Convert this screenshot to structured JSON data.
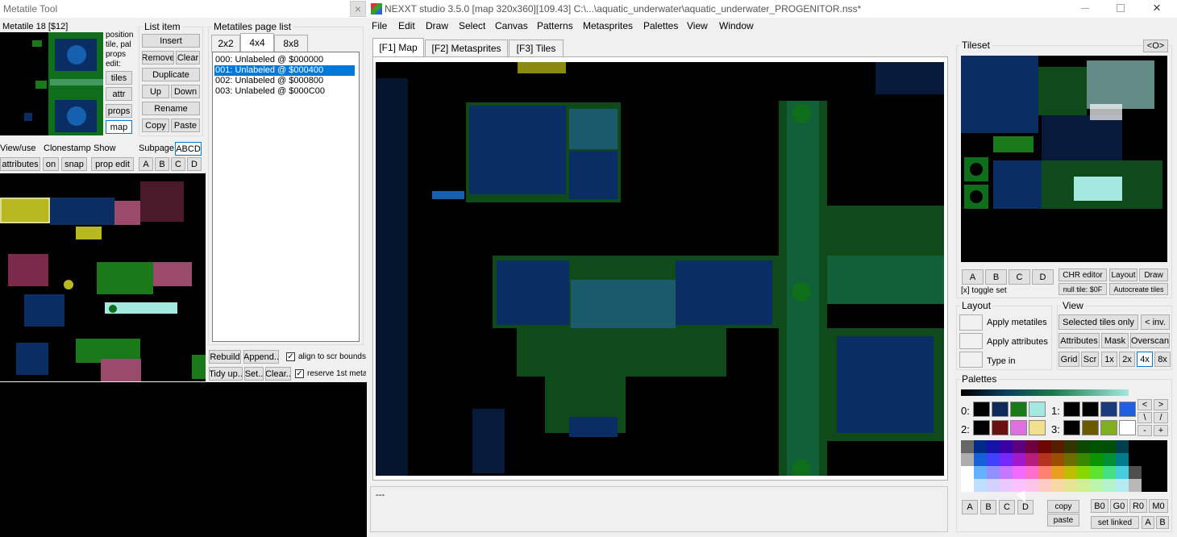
{
  "metatile_window": {
    "title": "Metatile Tool",
    "close": "×",
    "metatile_label": "Metatile 18 [$12]",
    "info_text": [
      "position",
      "tile, pal",
      "props",
      "edit:"
    ],
    "side_buttons": [
      "tiles",
      "attr",
      "props",
      "map"
    ],
    "list_item": {
      "title": "List item",
      "insert": "Insert",
      "remove": "Remove",
      "clear": "Clear",
      "duplicate": "Duplicate",
      "up": "Up",
      "down": "Down",
      "rename": "Rename",
      "copy": "Copy",
      "paste": "Paste"
    },
    "page_list": {
      "title": "Metatiles page list",
      "tabs": [
        "2x2",
        "4x4",
        "8x8"
      ],
      "items": [
        "000: Unlabeled @ $000000",
        "001: Unlabeled @ $000400",
        "002: Unlabeled @ $000800",
        "003: Unlabeled @ $000C00"
      ],
      "selected_index": 1
    },
    "view_use": "View/use",
    "clonestamp": "Clonestamp",
    "show": "Show",
    "subpage": "Subpage",
    "abcd": "ABCD",
    "attributes_btn": "attributes",
    "on_btn": "on",
    "snap_btn": "snap",
    "prop_edit_btn": "prop edit",
    "subpage_letters": [
      "A",
      "B",
      "C",
      "D"
    ],
    "rebuild": "Rebuild",
    "append": "Append..",
    "align_label": "align to scr bounds",
    "tidy": "Tidy up..",
    "set": "Set..",
    "clear_btn": "Clear..",
    "reserve_label": "reserve 1st meta"
  },
  "main_window": {
    "title": "NEXXT studio 3.5.0  [map 320x360][109.43] C:\\...\\aquatic_underwater\\aquatic_underwater_PROGENITOR.nss*",
    "menu": [
      "File",
      "Edit",
      "Draw",
      "Select",
      "Canvas",
      "Patterns",
      "Metasprites",
      "Palettes",
      "View",
      "Window"
    ],
    "tabs": [
      "[F1] Map",
      "[F2] Metasprites",
      "[F3] Tiles"
    ],
    "status_text": "---",
    "tileset": {
      "title": "Tileset",
      "toggle_btn": "<O>",
      "set_buttons": [
        "A",
        "B",
        "C",
        "D"
      ],
      "chr_editor": "CHR editor",
      "layout": "Layout",
      "draw": "Draw",
      "toggle_set": "[x] toggle set",
      "null_tile": "null tile: $0F",
      "autocreate": "Autocreate tiles"
    },
    "layout_group": {
      "title": "Layout",
      "apply_metatiles": "Apply metatiles",
      "apply_attributes": "Apply attributes",
      "type_in": "Type in"
    },
    "view_group": {
      "title": "View",
      "selected_tiles_only": "Selected tiles only",
      "inv": "< inv.",
      "attributes": "Attributes",
      "mask": "Mask",
      "overscan": "Overscan",
      "grid": "Grid",
      "scr": "Scr",
      "zoom": [
        "1x",
        "2x",
        "4x",
        "8x"
      ],
      "zoom_selected": "4x"
    },
    "palettes": {
      "title": "Palettes",
      "labels": [
        "0:",
        "1:",
        "2:",
        "3:"
      ],
      "sets": [
        [
          "#000000",
          "#0f2a5a",
          "#1a7a1a",
          "#a4e8e0"
        ],
        [
          "#000000",
          "#000000",
          "#1a3a7a",
          "#2060e0"
        ],
        [
          "#000000",
          "#6a1010",
          "#e070e0",
          "#f0e090"
        ],
        [
          "#000000",
          "#6a5a00",
          "#80b020",
          "#ffffff"
        ]
      ],
      "arrow_buttons": [
        "<",
        ">",
        "\\",
        "/",
        "-",
        "+"
      ],
      "bank_buttons": [
        "A",
        "B",
        "C",
        "D"
      ],
      "copy": "copy",
      "paste": "paste",
      "b0": "B0",
      "g0": "G0",
      "r0": "R0",
      "m0": "M0",
      "set_linked": "set linked",
      "linked_ab": [
        "A",
        "B"
      ]
    }
  }
}
